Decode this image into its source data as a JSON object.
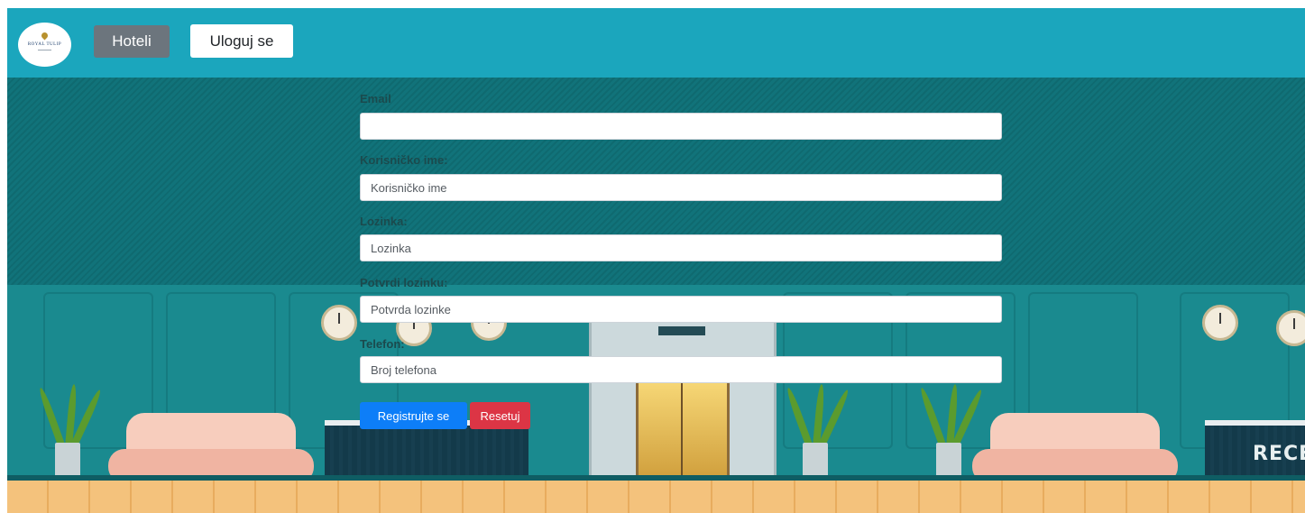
{
  "navbar": {
    "logo_text": "ROYAL TULIP",
    "hotels_label": "Hoteli",
    "login_label": "Uloguj se"
  },
  "form": {
    "email": {
      "label": "Email",
      "value": "",
      "placeholder": ""
    },
    "username": {
      "label": "Korisničko ime:",
      "value": "",
      "placeholder": "Korisničko ime"
    },
    "password": {
      "label": "Lozinka:",
      "value": "",
      "placeholder": "Lozinka"
    },
    "confirm_password": {
      "label": "Potvrdi lozinku:",
      "value": "",
      "placeholder": "Potvrda lozinke"
    },
    "phone": {
      "label": "Telefon:",
      "value": "",
      "placeholder": "Broj telefona"
    },
    "register_label": "Registrujte se",
    "reset_label": "Resetuj"
  },
  "background": {
    "reception_sign": "RECEF"
  },
  "colors": {
    "navbar": "#1ba6bd",
    "hotels_button": "#6c757d",
    "register_button": "#0d7ef8",
    "reset_button": "#dc3545"
  }
}
